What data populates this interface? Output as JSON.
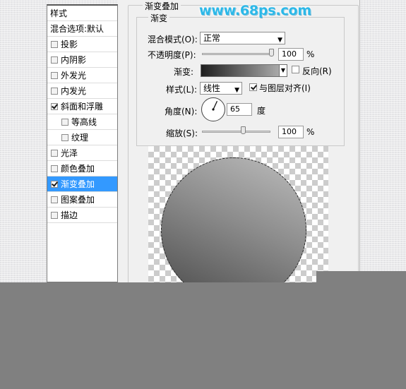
{
  "watermark": "www.68ps.com",
  "left_panel": {
    "header": "样式",
    "blend_default": "混合选项:默认",
    "items": [
      {
        "label": "投影",
        "checked": false,
        "selected": false,
        "indent": false
      },
      {
        "label": "内阴影",
        "checked": false,
        "selected": false,
        "indent": false
      },
      {
        "label": "外发光",
        "checked": false,
        "selected": false,
        "indent": false
      },
      {
        "label": "内发光",
        "checked": false,
        "selected": false,
        "indent": false
      },
      {
        "label": "斜面和浮雕",
        "checked": true,
        "selected": false,
        "indent": false
      },
      {
        "label": "等高线",
        "checked": false,
        "selected": false,
        "indent": true
      },
      {
        "label": "纹理",
        "checked": false,
        "selected": false,
        "indent": true
      },
      {
        "label": "光泽",
        "checked": false,
        "selected": false,
        "indent": false
      },
      {
        "label": "颜色叠加",
        "checked": false,
        "selected": false,
        "indent": false
      },
      {
        "label": "渐变叠加",
        "checked": true,
        "selected": true,
        "indent": false
      },
      {
        "label": "图案叠加",
        "checked": false,
        "selected": false,
        "indent": false
      },
      {
        "label": "描边",
        "checked": false,
        "selected": false,
        "indent": false
      }
    ]
  },
  "panel": {
    "section_title": "渐变叠加",
    "group_title": "渐变",
    "blend_mode_label": "混合模式(O):",
    "blend_mode_value": "正常",
    "opacity_label": "不透明度(P):",
    "opacity_value": "100",
    "opacity_unit": "%",
    "opacity_fraction": 1.0,
    "gradient_label": "渐变:",
    "reverse_label": "反向(R)",
    "reverse_checked": false,
    "style_label": "样式(L):",
    "style_value": "线性",
    "align_label": "与图层对齐(I)",
    "align_checked": true,
    "angle_label": "角度(N):",
    "angle_value": "65",
    "angle_unit": "度",
    "scale_label": "缩放(S):",
    "scale_value": "100",
    "scale_unit": "%",
    "scale_fraction": 0.6
  },
  "colors": {
    "selected_row": "#3399ff",
    "watermark": "#2bb8e8",
    "overlay": "#808080"
  }
}
